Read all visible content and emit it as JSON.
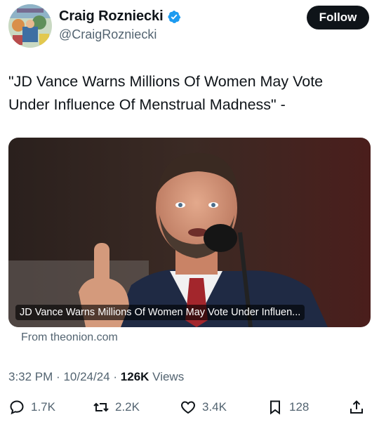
{
  "author": {
    "display_name": "Craig Rozniecki",
    "handle": "@CraigRozniecki",
    "verified": true
  },
  "follow_label": "Follow",
  "tweet_text": "\"JD Vance Warns Millions Of Women May Vote Under Influence Of Menstrual Madness\" -",
  "link_card": {
    "caption": "JD Vance Warns Millions Of Women May Vote Under Influen...",
    "source": "From theonion.com"
  },
  "meta": {
    "time": "3:32 PM",
    "separator": "·",
    "date": "10/24/24",
    "views_count": "126K",
    "views_label": "Views"
  },
  "actions": {
    "replies": "1.7K",
    "reposts": "2.2K",
    "likes": "3.4K",
    "bookmarks": "128"
  },
  "colors": {
    "text_primary": "#0f1419",
    "text_secondary": "#536471",
    "verified_blue": "#1d9bf0",
    "follow_bg": "#0f1419"
  }
}
